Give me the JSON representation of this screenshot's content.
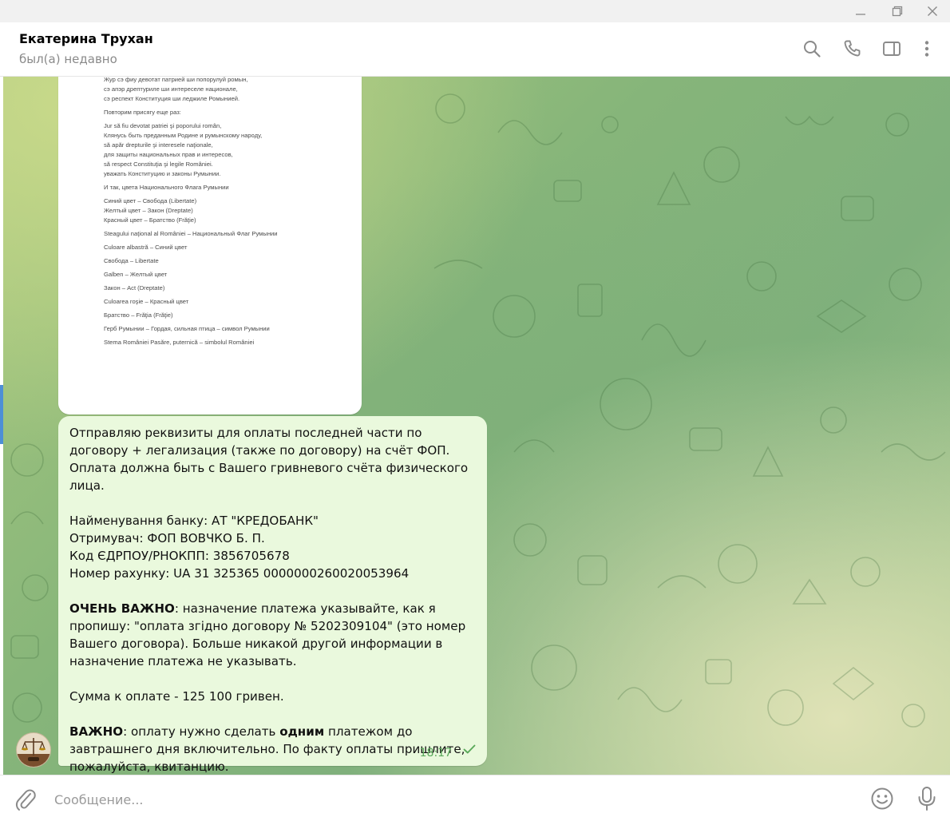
{
  "window": {
    "controls": [
      "minimize-icon",
      "restore-icon",
      "close-icon"
    ]
  },
  "header": {
    "contact_name": "Екатерина Трухан",
    "contact_status": "был(а) недавно",
    "icons": [
      "search-icon",
      "phone-icon",
      "sidebar-toggle-icon",
      "more-vertical-icon"
    ]
  },
  "document": {
    "lines": [
      "Жур сэ фиу девотат патрией ши попорулуй ромын,",
      "сэ апэр дрептуриле ши интереселе национале,",
      "сэ респект Конституция ши леджиле Ромынией.",
      "",
      "Повторим присягу еще раз:",
      "",
      "Jur să fiu devotat patriei şi poporului român,",
      "Клянусь быть преданным Родине и румынскому народу,",
      "să apăr drepturile şi interesele naţionale,",
      "для защиты национальных прав и интересов,",
      "să respect Constituţia şi legile României.",
      "уважать Конституцию и законы Румынии.",
      "",
      "И так, цвета Национального Флага Румынии",
      "",
      "Синий цвет – Свобода (Libertate)",
      "Желтый цвет – Закон (Dreptate)",
      "Красный цвет – Братство (Frăţie)",
      "",
      "Steagului naţional al României – Национальный Флаг Румынии",
      "",
      "Culoare albastră – Синий цвет",
      "",
      "Свобода – Libertate",
      "",
      "Galben – Желтый цвет",
      "",
      "Закон – Act (Dreptate)",
      "",
      "Culoarea roşie – Красный цвет",
      "",
      "Братство – Frăţia (Frăţie)",
      "",
      "Герб Румынии – Гордая, сильная птица – символ Румынии",
      "",
      "Stema României Pasăre, puternică – simbolul României"
    ]
  },
  "message": {
    "intro": "Отправляю реквизиты для оплаты последней части по договору + легализация (также по договору) на счёт ФОП. Оплата должна быть с Вашего гривневого счёта физического лица.",
    "bank_line": "Найменування банку:  АТ \"КРЕДОБАНК\"",
    "recipient_line": "Отримувач:  ФОП ВОВЧКО Б. П.",
    "code_line": "Код ЄДРПОУ/РНОКПП:  3856705678",
    "account_line": "Номер рахунку:  UA 31 325365 0000000260020053964",
    "very_important_label": "ОЧЕНЬ ВАЖНО",
    "very_important_text": ": назначение платежа указывайте, как я пропишу: \"оплата згідно договору № 5202309104\"  (это номер Вашего договора). Больше никакой другой информации в назначение платежа не указывать.",
    "sum_line": "Сумма к оплате - 125 100 гривен.",
    "important_label": "ВАЖНО",
    "important_text_1": ": оплату нужно сделать ",
    "important_bold": "одним",
    "important_text_2": " платежом до завтрашнего дня включительно. По факту оплаты пришлите, пожалуйста, квитанцию.",
    "time": "18:17"
  },
  "input": {
    "placeholder": "Сообщение..."
  },
  "colors": {
    "bubble": "#eaf9dd",
    "time": "#5aa95a",
    "accent": "#4d8fd6"
  }
}
